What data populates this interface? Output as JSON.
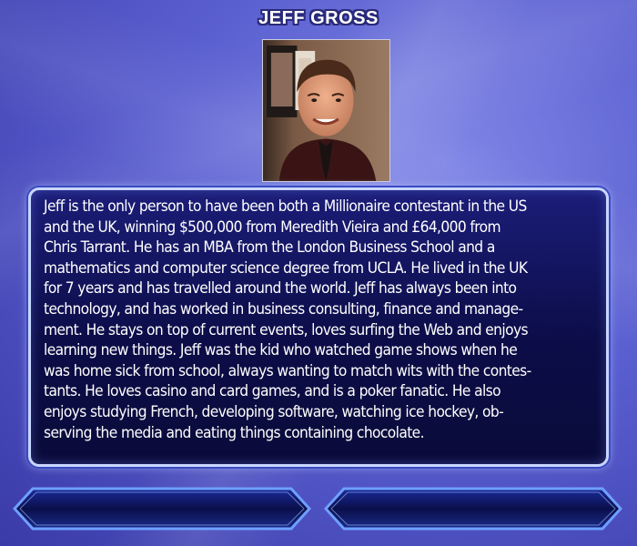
{
  "title": "JEFF GROSS",
  "photo": {
    "alt": "Jeff Gross"
  },
  "bio": {
    "lines": [
      "Jeff is the only person to have been both a Millionaire contestant in the US",
      "and the UK, winning $500,000 from Meredith Vieira and £64,000 from",
      "Chris Tarrant. He has an MBA from the London Business School and a",
      "mathematics and computer science degree from UCLA. He lived in the UK",
      "for 7 years and has travelled around the world. Jeff has always been into",
      "technology, and has worked in business consulting, finance and manage-",
      "ment. He stays on top of current events, loves surfing the Web and enjoys",
      "learning new things. Jeff was the kid who watched game shows when he",
      "was home sick from school, always wanting to match wits with the contes-",
      "tants. He loves casino and card games, and is a poker fanatic. He also",
      "enjoys studying French, developing software, watching ice hockey, ob-",
      "serving the media and eating things containing chocolate."
    ]
  },
  "buttons": {
    "left_label": "",
    "right_label": ""
  },
  "colors": {
    "background": "#5a5fd0",
    "panel": "#0c0d48",
    "panel_border": "#c9d6ff"
  }
}
